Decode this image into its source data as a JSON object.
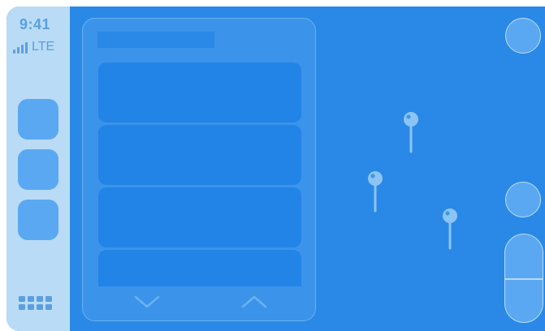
{
  "status_bar": {
    "time": "9:41",
    "network": "LTE",
    "signal_bars": 4
  },
  "colors": {
    "map_background": "#2a89e6",
    "rail_background": "#b9dbf6",
    "accent": "#5aa8f2",
    "panel": "#3b94ea"
  },
  "rail": {
    "app_buttons": [
      "app-slot-1",
      "app-slot-2",
      "app-slot-3"
    ],
    "dashboard_icon": "app-grid-icon"
  },
  "panel": {
    "list_items": 4,
    "scroll_down_icon": "chevron-down-icon",
    "scroll_up_icon": "chevron-up-icon"
  },
  "map": {
    "pins": [
      "map-pin-icon",
      "map-pin-icon",
      "map-pin-icon"
    ],
    "controls": [
      "top-round-button",
      "middle-round-button",
      "zoom-in-button",
      "zoom-out-button"
    ]
  }
}
